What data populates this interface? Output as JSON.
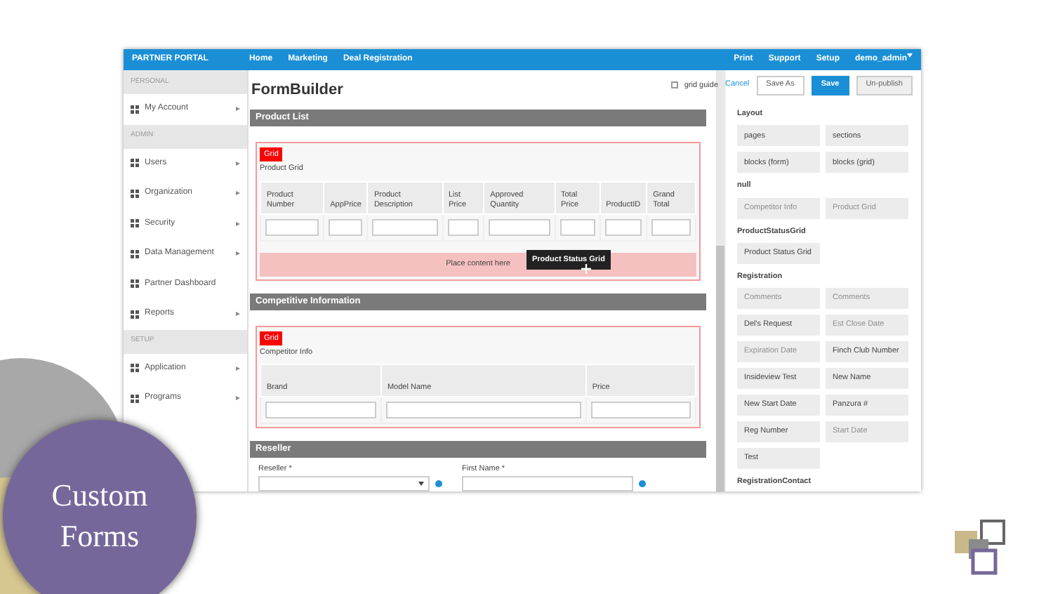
{
  "navbar": {
    "brand": "PARTNER PORTAL",
    "links": [
      "Home",
      "Marketing",
      "Deal Registration"
    ],
    "right_links": [
      "Print",
      "Support",
      "Setup"
    ],
    "user": "demo_admin"
  },
  "sidebar": [
    {
      "kind": "header",
      "label": "PERSONAL"
    },
    {
      "kind": "item",
      "label": "My Account",
      "expandable": true
    },
    {
      "kind": "header",
      "label": "ADMIN"
    },
    {
      "kind": "item",
      "label": "Users",
      "expandable": true
    },
    {
      "kind": "item",
      "label": "Organization",
      "expandable": true
    },
    {
      "kind": "item",
      "label": "Security",
      "expandable": true
    },
    {
      "kind": "item",
      "label": "Data Management",
      "expandable": true
    },
    {
      "kind": "item",
      "label": "Partner Dashboard",
      "expandable": false
    },
    {
      "kind": "item",
      "label": "Reports",
      "expandable": true
    },
    {
      "kind": "header",
      "label": "SETUP"
    },
    {
      "kind": "item",
      "label": "Application",
      "expandable": true
    },
    {
      "kind": "item",
      "label": "Programs",
      "expandable": true
    }
  ],
  "page_title": "FormBuilder",
  "grid_guide": {
    "label": "grid guide",
    "checked": false
  },
  "actions": [
    {
      "label": "Cancel",
      "kind": "link"
    },
    {
      "label": "Save As",
      "kind": "default"
    },
    {
      "label": "Save",
      "kind": "primary"
    },
    {
      "label": "Un-publish",
      "kind": "muted"
    }
  ],
  "sections": [
    {
      "title": "Product List",
      "kind": "grid",
      "badge": "Grid",
      "caption": "Product Grid",
      "columns": [
        "Product Number",
        "AppPrice",
        "Product Description",
        "List Price",
        "Approved Quantity",
        "Total Price",
        "ProductID",
        "Grand Total"
      ],
      "dropzone": "Place content here",
      "drag_ghost": "Product Status Grid"
    },
    {
      "title": "Competitive Information",
      "kind": "grid",
      "badge": "Grid",
      "caption": "Competitor Info",
      "columns": [
        "Brand",
        "Model Name",
        "Price"
      ]
    },
    {
      "title": "Reseller",
      "kind": "form",
      "fields": [
        {
          "label": "Reseller *",
          "kind": "select"
        },
        {
          "label": "First Name *",
          "kind": "text"
        }
      ]
    }
  ],
  "palette": [
    {
      "group": "Layout",
      "items": [
        {
          "label": "pages",
          "disabled": false
        },
        {
          "label": "sections",
          "disabled": false
        },
        {
          "label": "blocks (form)",
          "disabled": false
        },
        {
          "label": "blocks (grid)",
          "disabled": false
        }
      ]
    },
    {
      "group": "null",
      "items": [
        {
          "label": "Competitor Info",
          "disabled": true
        },
        {
          "label": "Product Grid",
          "disabled": true
        }
      ]
    },
    {
      "group": "ProductStatusGrid",
      "items": [
        {
          "label": "Product Status Grid",
          "disabled": false
        }
      ]
    },
    {
      "group": "Registration",
      "items": [
        {
          "label": "Comments",
          "disabled": true
        },
        {
          "label": "Comments",
          "disabled": true
        },
        {
          "label": "Del's Request",
          "disabled": false
        },
        {
          "label": "Est Close Date",
          "disabled": true
        },
        {
          "label": "Expiration Date",
          "disabled": true
        },
        {
          "label": "Finch Club Number",
          "disabled": false
        },
        {
          "label": "Insideview Test",
          "disabled": false
        },
        {
          "label": "New Name",
          "disabled": false
        },
        {
          "label": "New Start Date",
          "disabled": false
        },
        {
          "label": "Panzura #",
          "disabled": false
        },
        {
          "label": "Reg Number",
          "disabled": false
        },
        {
          "label": "Start Date",
          "disabled": true
        },
        {
          "label": "Test",
          "disabled": false
        }
      ]
    },
    {
      "group": "RegistrationContact"
    }
  ],
  "slide_title": "Custom Forms"
}
